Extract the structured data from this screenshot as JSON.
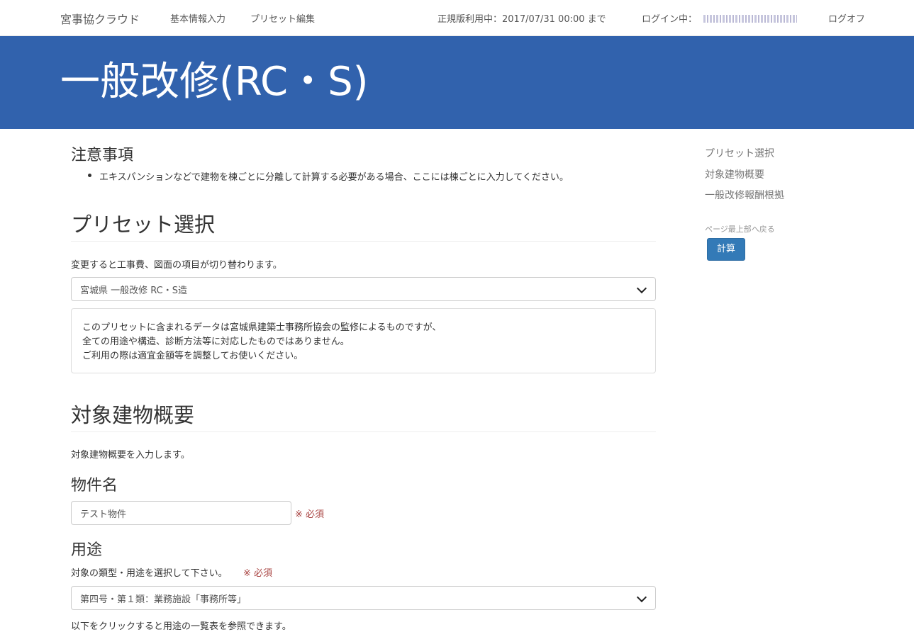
{
  "nav": {
    "brand": "宮事協クラウド",
    "basic_info": "基本情報入力",
    "preset_edit": "プリセット編集",
    "status": "正規版利用中：2017/07/31 00:00 まで",
    "login_label": "ログイン中：",
    "logoff": "ログオフ"
  },
  "header": {
    "title": "一般改修(RC・S)"
  },
  "notice": {
    "title": "注意事項",
    "items": [
      "エキスパンションなどで建物を棟ごとに分離して計算する必要がある場合、ここには棟ごとに入力してください。"
    ]
  },
  "preset": {
    "title": "プリセット選択",
    "description": "変更すると工事費、図面の項目が切り替わります。",
    "selected": "宮城県 一般改修 RC・S造",
    "panel_lines": [
      "このプリセットに含まれるデータは宮城県建築士事務所協会の監修によるものですが、",
      "全ての用途や構造、診断方法等に対応したものではありません。",
      "ご利用の際は適宜金額等を調整してお使いください。"
    ]
  },
  "building": {
    "title": "対象建物概要",
    "description": "対象建物概要を入力します。",
    "name_label": "物件名",
    "name_value": "テスト物件",
    "required": "※ 必須",
    "use_label": "用途",
    "use_description": "対象の類型・用途を選択して下さい。",
    "use_selected": "第四号・第１類：業務施設「事務所等」",
    "use_hint": "以下をクリックすると用途の一覧表を参照できます。"
  },
  "sidebar": {
    "items": [
      "プリセット選択",
      "対象建物概要",
      "一般改修報酬根拠"
    ],
    "back_to_top": "ページ最上部へ戻る",
    "calc_button": "計算"
  },
  "colors": {
    "header_bg": "#3162ad",
    "primary_button": "#337ab7",
    "required_text": "#a94442"
  }
}
